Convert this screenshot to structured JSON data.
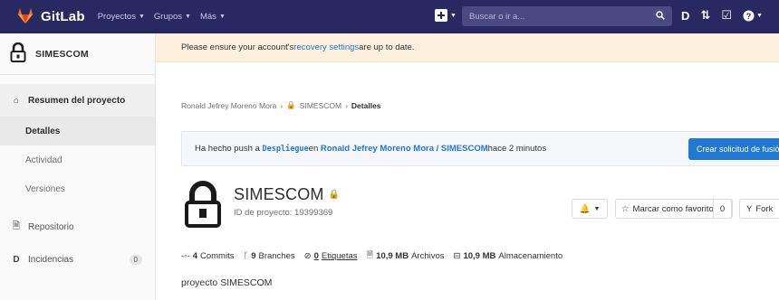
{
  "navbar": {
    "brand": "GitLab",
    "links": [
      "Proyectos",
      "Grupos",
      "Más"
    ],
    "search_placeholder": "Buscar o ir a...",
    "icons": [
      "gitlab-logo-icon",
      "plus-icon",
      "search-icon",
      "issues-icon",
      "merge-request-icon",
      "todo-icon",
      "help-icon"
    ],
    "colors": {
      "background": "#292961",
      "accent": "#e24329"
    }
  },
  "sidebar": {
    "project_name": "SIMESCOM",
    "overview": "Resumen del proyecto",
    "sub_items": [
      "Detalles",
      "Actividad",
      "Versiones"
    ],
    "repository": "Repositorio",
    "issues": "Incidencias",
    "issues_count": "0"
  },
  "alert": {
    "text_before": "Please ensure your account's ",
    "link": "recovery settings",
    "text_after": " are up to date."
  },
  "breadcrumb": [
    "Ronald Jefrey Moreno Mora",
    "SIMESCOM",
    "Detalles"
  ],
  "push": {
    "prefix": "Ha hecho push a ",
    "branch": "Despliegue",
    "middle": " en ",
    "project": "Ronald Jefrey Moreno Mora / SIMESCOM",
    "suffix": " hace 2 minutos",
    "button": "Crear solicitud de fusión"
  },
  "project": {
    "name": "SIMESCOM",
    "id_text": "ID de proyecto: 19399369",
    "star_label": "Marcar como favorito",
    "star_count": "0",
    "fork_label": "Fork",
    "description": "proyecto SIMESCOM"
  },
  "stats": {
    "commits_n": "4",
    "commits_label": "Commits",
    "branches_n": "9",
    "branches_label": "Branches",
    "tags_n": "0",
    "tags_label": "Etiquetas",
    "files_n": "10,9 MB",
    "files_label": "Archivos",
    "storage_n": "10,9 MB",
    "storage_label": "Almacenamiento"
  }
}
